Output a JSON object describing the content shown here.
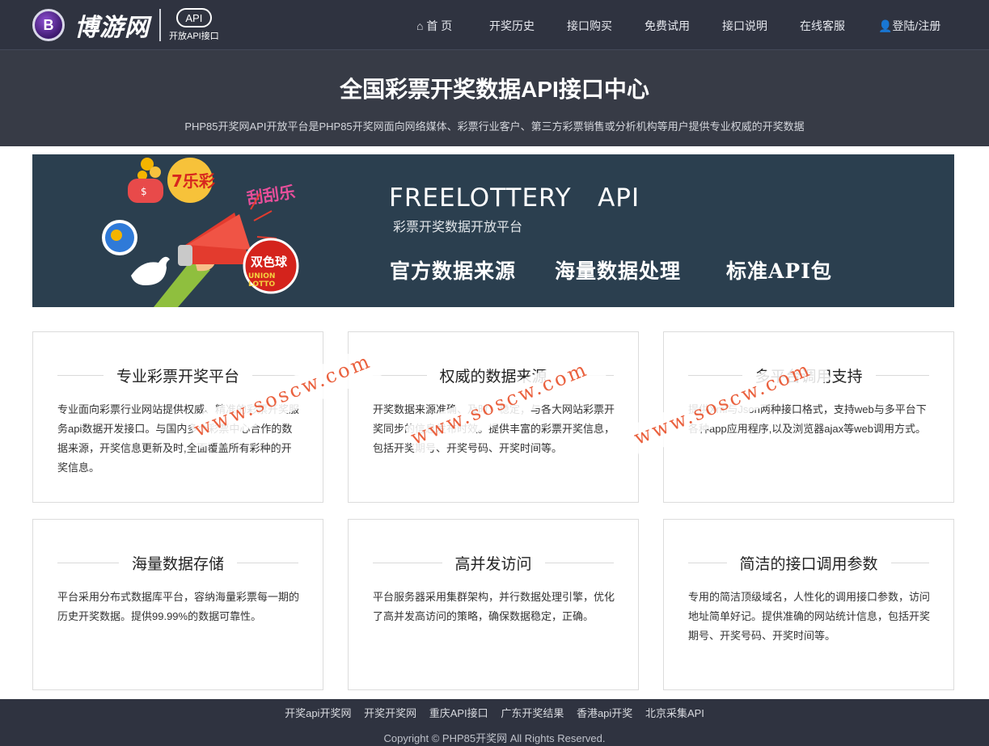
{
  "header": {
    "logo_mark": "B",
    "logo_text": "博游网",
    "api_badge": "API",
    "api_sub": "开放API接口",
    "nav": [
      {
        "label": "⌂ 首 页",
        "icon": "home-icon"
      },
      {
        "label": "开奖历史"
      },
      {
        "label": "接口购买"
      },
      {
        "label": "免费试用"
      },
      {
        "label": "接口说明"
      },
      {
        "label": "在线客服"
      },
      {
        "label": "👤登陆/注册",
        "icon": "user-icon"
      }
    ]
  },
  "hero": {
    "title": "全国彩票开奖数据API接口中心",
    "subtitle": "PHP85开奖网API开放平台是PHP85开奖网面向网络媒体、彩票行业客户、第三方彩票销售或分析机构等用户提供专业权威的开奖数据"
  },
  "banner": {
    "title": "FREELOTTERY   API",
    "subtitle": "彩票开奖数据开放平台",
    "features": [
      "官方数据来源",
      "海量数据处理",
      "标准API包"
    ],
    "badges": [
      "7乐彩",
      "刮刮乐",
      "双色球",
      "UNION LOTTO",
      "$"
    ]
  },
  "cards": [
    {
      "title": "专业彩票开奖平台",
      "desc": "专业面向彩票行业网站提供权威、精准的彩票开奖服务api数据开发接口。与国内多个彩票中心合作的数据来源，开奖信息更新及时,全面覆盖所有彩种的开奖信息。"
    },
    {
      "title": "权威的数据来源",
      "desc": "开奖数据来源准确、及时，稳定，与各大网站彩票开奖同步的信息发布时效。提供丰富的彩票开奖信息，包括开奖期号、开奖号码、开奖时间等。"
    },
    {
      "title": "多平台调用支持",
      "desc": "提供Xml与Json两种接口格式，支持web与多平台下各种app应用程序,以及浏览器ajax等web调用方式。"
    },
    {
      "title": "海量数据存储",
      "desc": "平台采用分布式数据库平台，容纳海量彩票每一期的历史开奖数据。提供99.99%的数据可靠性。"
    },
    {
      "title": "高并发访问",
      "desc": "平台服务器采用集群架构，并行数据处理引擎，优化了高并发高访问的策略，确保数据稳定，正确。"
    },
    {
      "title": "简洁的接口调用参数",
      "desc": "专用的简洁顶级域名，人性化的调用接口参数，访问地址简单好记。提供准确的网站统计信息，包括开奖期号、开奖号码、开奖时间等。"
    }
  ],
  "watermark": "www.soscw.com",
  "footer": {
    "links": [
      "开奖api开奖网",
      "开奖开奖网",
      "重庆API接口",
      "广东开奖结果",
      "香港api开奖",
      "北京采集API"
    ],
    "copyright": "Copyright © PHP85开奖网 All Rights Reserved."
  },
  "colors": {
    "topbar": "#2f3340",
    "hero": "#373b46",
    "banner": "#2b3f4f",
    "watermark": "#e8502a"
  }
}
